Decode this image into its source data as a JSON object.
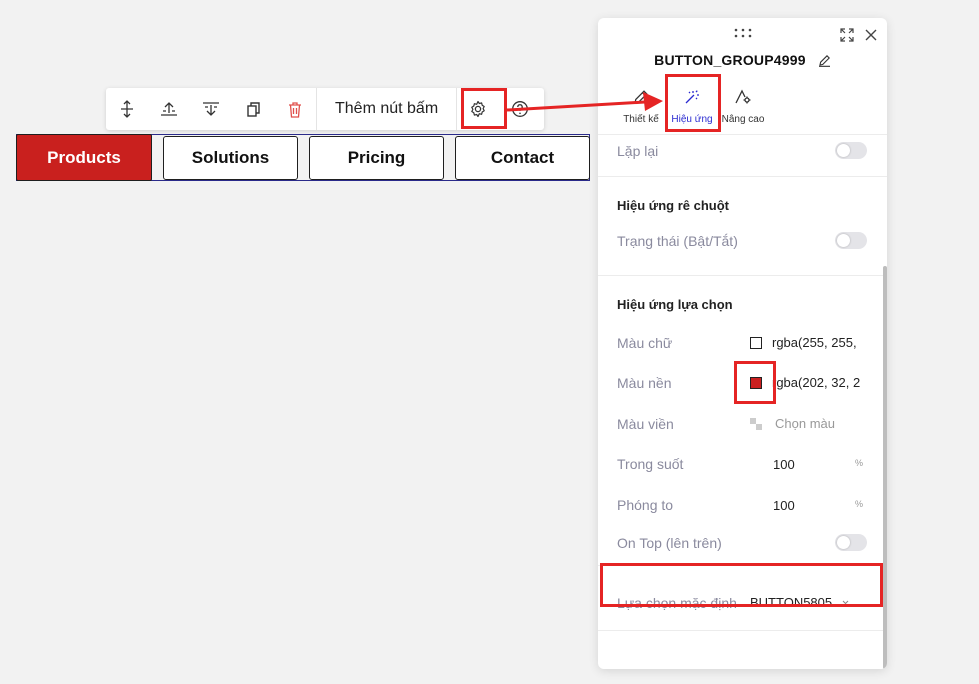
{
  "toolbar": {
    "add_button_label": "Thêm nút bấm",
    "icons": [
      "move-vertical-icon",
      "align-top-icon",
      "align-bottom-icon",
      "duplicate-icon",
      "delete-icon",
      "gear-icon",
      "help-icon"
    ]
  },
  "button_group": {
    "buttons": [
      {
        "label": "Products",
        "active": true
      },
      {
        "label": "Solutions",
        "active": false
      },
      {
        "label": "Pricing",
        "active": false
      },
      {
        "label": "Contact",
        "active": false
      }
    ],
    "active_color": "#c9201e"
  },
  "panel": {
    "title": "BUTTON_GROUP4999",
    "tabs": [
      {
        "label": "Thiết kế",
        "icon": "pencil-icon"
      },
      {
        "label": "Hiệu ứng",
        "icon": "magic-wand-icon",
        "active": true
      },
      {
        "label": "Nâng cao",
        "icon": "advanced-settings-icon"
      }
    ],
    "repeat_label": "Lặp lại",
    "hover_section": {
      "title": "Hiệu ứng rê chuột",
      "state_label": "Trạng thái (Bật/Tắt)"
    },
    "select_section": {
      "title": "Hiệu ứng lựa chọn",
      "text_color_label": "Màu chữ",
      "text_color_value": "rgba(255, 255,",
      "bg_color_label": "Màu nền",
      "bg_color_value": "rgba(202, 32, 2",
      "border_color_label": "Màu viền",
      "border_color_value": "Chọn màu",
      "opacity_label": "Trong suốt",
      "opacity_value": "100",
      "opacity_unit": "%",
      "zoom_label": "Phóng to",
      "zoom_value": "100",
      "zoom_unit": "%",
      "on_top_label": "On Top (lên trên)",
      "default_label": "Lựa chọn mặc định",
      "default_value": "BUTTON5805"
    },
    "accent_color": "#2a2ad0",
    "highlight_color": "#e52424"
  }
}
